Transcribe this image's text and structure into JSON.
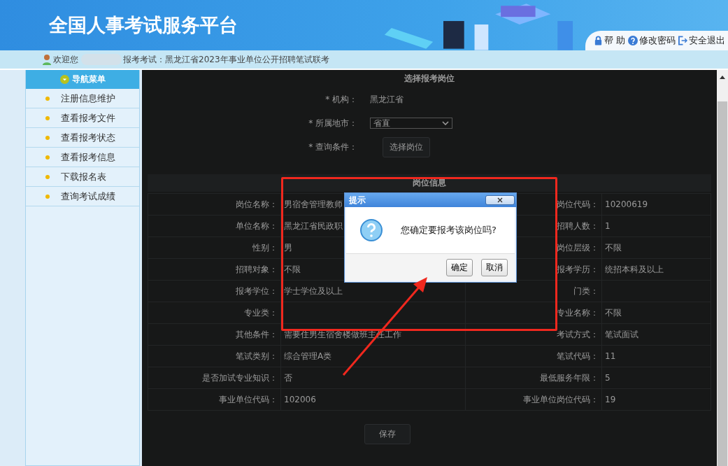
{
  "header": {
    "title": "全国人事考试服务平台",
    "links": [
      {
        "kind": "lock",
        "label": "帮 助"
      },
      {
        "kind": "help",
        "label": "修改密码"
      },
      {
        "kind": "exit",
        "label": "安全退出"
      }
    ]
  },
  "welcome": {
    "greeting": "欢迎您",
    "exam": "报考考试：黑龙江省2023年事业单位公开招聘笔试联考"
  },
  "sidebar": {
    "title": "导航菜单",
    "items": [
      {
        "label": "注册信息维护"
      },
      {
        "label": "查看报考文件"
      },
      {
        "label": "查看报考状态"
      },
      {
        "label": "查看报考信息"
      },
      {
        "label": "下载报名表"
      },
      {
        "label": "查询考试成绩"
      }
    ]
  },
  "form": {
    "title": "选择报考岗位",
    "fields": [
      {
        "kind": "text",
        "label": "* 机构：",
        "value": "黑龙江省"
      },
      {
        "kind": "select",
        "label": "* 所属地市：",
        "value": "省直"
      },
      {
        "kind": "button",
        "label": "* 查询条件：",
        "value": "选择岗位"
      }
    ]
  },
  "job_info": {
    "title": "岗位信息",
    "rows": [
      {
        "label_1": "岗位名称：",
        "value_1": "男宿舍管理教师",
        "label_2": "岗位代码：",
        "value_2": "10200619"
      },
      {
        "label_1": "单位名称：",
        "value_1": "黑龙江省民政职",
        "label_2": "招聘人数：",
        "value_2": "1"
      },
      {
        "label_1": "性别：",
        "value_1": "男",
        "label_2": "岗位层级：",
        "value_2": "不限"
      },
      {
        "label_1": "招聘对象：",
        "value_1": "不限",
        "label_2": "报考学历：",
        "value_2": "统招本科及以上"
      },
      {
        "label_1": "报考学位：",
        "value_1": "学士学位及以上",
        "label_2": "门类："
      },
      {
        "label_1": "专业类：",
        "label_2": "专业名称：",
        "value_2": "不限"
      },
      {
        "label_1": "其他条件：",
        "value_1": "需要住男生宿舍楼做班主任工作",
        "label_2": "考试方式：",
        "value_2": "笔试面试"
      },
      {
        "label_1": "笔试类别：",
        "value_1": "综合管理A类",
        "label_2": "笔试代码：",
        "value_2": "11"
      },
      {
        "label_1": "是否加试专业知识：",
        "value_1": "否",
        "label_2": "最低服务年限：",
        "value_2": "5"
      },
      {
        "label_1": "事业单位代码：",
        "value_1": "102006",
        "label_2": "事业单位岗位代码：",
        "value_2": "19"
      }
    ]
  },
  "save_button": "保存",
  "dialog": {
    "title": "提示",
    "message": "您确定要报考该岗位吗?",
    "buttons": [
      "确定",
      "取消"
    ]
  }
}
